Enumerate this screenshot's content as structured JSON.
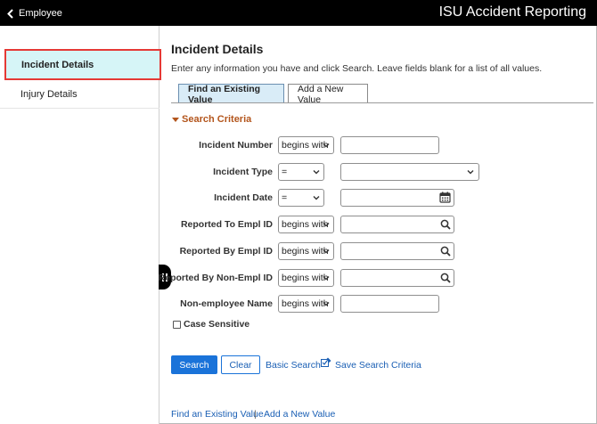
{
  "header": {
    "back_label": "Employee",
    "app_title": "ISU Accident Reporting"
  },
  "sidebar": {
    "items": [
      {
        "label": "Incident Details",
        "active": true
      },
      {
        "label": "Injury Details",
        "active": false
      }
    ]
  },
  "page": {
    "title": "Incident Details",
    "instructions": "Enter any information you have and click Search. Leave fields blank for a list of all values."
  },
  "tabs": [
    {
      "label": "Find an Existing Value",
      "active": true
    },
    {
      "label": "Add a New Value",
      "active": false
    }
  ],
  "search": {
    "section_title": "Search Criteria",
    "fields": [
      {
        "label": "Incident Number",
        "operator": "begins with",
        "value": "",
        "icon": ""
      },
      {
        "label": "Incident Type",
        "operator": "=",
        "value": "",
        "icon": "chevron-down-icon"
      },
      {
        "label": "Incident Date",
        "operator": "=",
        "value": "",
        "icon": "calendar-icon"
      },
      {
        "label": "Reported To Empl ID",
        "operator": "begins with",
        "value": "",
        "icon": "search-icon"
      },
      {
        "label": "Reported By Empl ID",
        "operator": "begins with",
        "value": "",
        "icon": "search-icon"
      },
      {
        "label": "Reported By Non-Empl ID",
        "operator": "begins with",
        "value": "",
        "icon": "search-icon"
      },
      {
        "label": "Non-employee Name",
        "operator": "begins with",
        "value": "",
        "icon": ""
      }
    ],
    "case_sensitive_label": "Case Sensitive",
    "case_sensitive_checked": false
  },
  "actions": {
    "search_label": "Search",
    "clear_label": "Clear",
    "basic_search_label": "Basic Search",
    "save_criteria_label": "Save Search Criteria"
  },
  "footer": {
    "find_link": "Find an Existing Value",
    "separator": "|",
    "add_link": "Add a New Value"
  },
  "colors": {
    "topbar": "#000000",
    "active_item_bg": "#d6f5f7",
    "active_item_border": "#e53935",
    "accent_blue": "#1a73d9",
    "section_header": "#b3551c"
  }
}
